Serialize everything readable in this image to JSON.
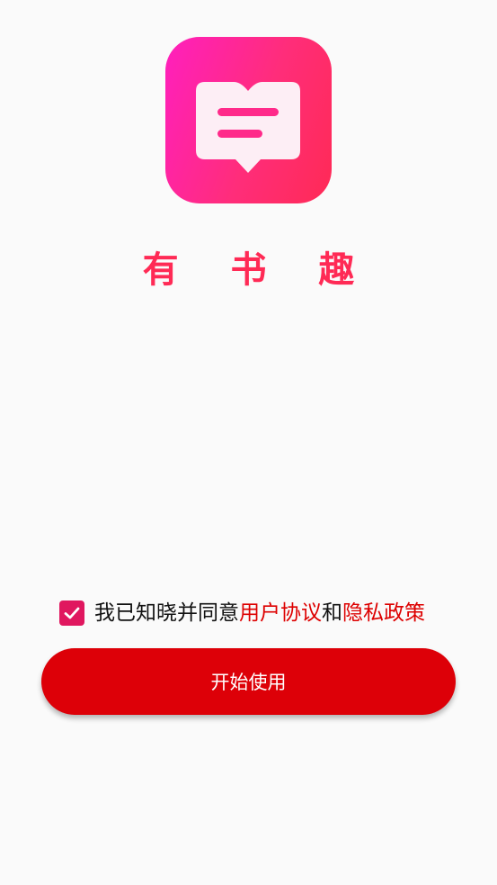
{
  "colors": {
    "brand": "#ff2a55",
    "link": "#dd0000",
    "button": "#dd0008",
    "checkbox": "#e0175f"
  },
  "app": {
    "icon": "book-speech-bubble-icon",
    "name": "有 书 趣"
  },
  "agreement": {
    "checked": true,
    "check_icon": "checkmark-icon",
    "prefix": "我已知晓并同意",
    "user_agreement": "用户协议",
    "conjunction": "和",
    "privacy_policy": "隐私政策"
  },
  "start_button": {
    "label": "开始使用"
  }
}
